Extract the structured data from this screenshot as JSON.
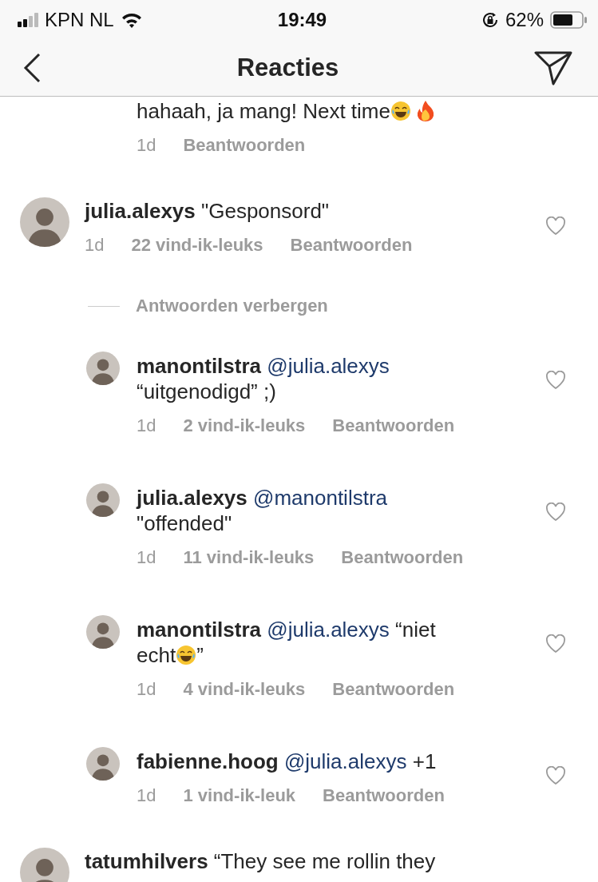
{
  "status_bar": {
    "carrier": "KPN NL",
    "time": "19:49",
    "battery": "62%"
  },
  "header": {
    "title": "Reacties"
  },
  "comments": [
    {
      "kind": "reply",
      "body": [
        {
          "kind": "text",
          "text": "hahaah, ja mang! Next time"
        },
        {
          "kind": "laugh"
        },
        {
          "kind": "fire"
        }
      ],
      "time": "1d",
      "reply_label": "Beantwoorden"
    },
    {
      "kind": "comment",
      "username": "julia.alexys",
      "body": [
        {
          "kind": "text",
          "text": "\"Gesponsord\""
        }
      ],
      "time": "1d",
      "likes": "22 vind-ik-leuks",
      "reply_label": "Beantwoorden",
      "liked": false,
      "toggle": "Antwoorden verbergen",
      "children": [
        {
          "kind": "reply",
          "username": "manontilstra",
          "mention": "@julia.alexys",
          "body": [
            {
              "kind": "break"
            },
            {
              "kind": "text",
              "text": "“uitgenodigd” ;)"
            }
          ],
          "time": "1d",
          "likes": "2 vind-ik-leuks",
          "reply_label": "Beantwoorden",
          "liked": false
        },
        {
          "kind": "reply",
          "username": "julia.alexys",
          "mention": "@manontilstra",
          "body": [
            {
              "kind": "break"
            },
            {
              "kind": "text",
              "text": "\"offended\""
            }
          ],
          "time": "1d",
          "likes": "11 vind-ik-leuks",
          "reply_label": "Beantwoorden",
          "liked": false
        },
        {
          "kind": "reply",
          "username": "manontilstra",
          "mention": "@julia.alexys",
          "body": [
            {
              "kind": "text",
              "text": " “niet"
            },
            {
              "kind": "break"
            },
            {
              "kind": "text",
              "text": "echt"
            },
            {
              "kind": "laugh"
            },
            {
              "kind": "text",
              "text": "”"
            }
          ],
          "time": "1d",
          "likes": "4 vind-ik-leuks",
          "reply_label": "Beantwoorden",
          "liked": false
        },
        {
          "kind": "reply",
          "username": "fabienne.hoog",
          "mention": "@julia.alexys",
          "body": [
            {
              "kind": "text",
              "text": " +1"
            }
          ],
          "time": "1d",
          "likes": "1 vind-ik-leuk",
          "reply_label": "Beantwoorden",
          "liked": false
        }
      ]
    },
    {
      "kind": "comment",
      "username": "tatumhilvers",
      "body": [
        {
          "kind": "text",
          "text": "“They see me rollin they"
        }
      ]
    }
  ]
}
